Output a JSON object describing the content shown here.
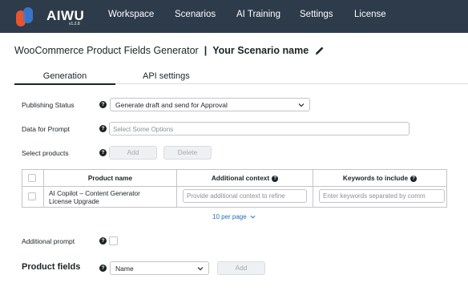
{
  "header": {
    "logo_text": "AIWU",
    "version": "v1.2.8",
    "nav": [
      "Workspace",
      "Scenarios",
      "AI Training",
      "Settings",
      "License"
    ]
  },
  "title": {
    "product": "WooCommerce Product Fields Generator",
    "separator": "|",
    "scenario_name": "Your Scenario name"
  },
  "tabs": [
    "Generation",
    "API settings"
  ],
  "form": {
    "publishing_status": {
      "label": "Publishing Status",
      "value": "Generate draft and send for Approval"
    },
    "data_for_prompt": {
      "label": "Data for Prompt",
      "placeholder": "Select Some Options"
    },
    "select_products": {
      "label": "Select products",
      "add": "Add",
      "delete": "Delete"
    },
    "additional_prompt": {
      "label": "Additional prompt"
    },
    "product_fields": {
      "label": "Product fields",
      "value": "Name",
      "add": "Add"
    }
  },
  "table": {
    "columns": [
      "Product name",
      "Additional context",
      "Keywords to include"
    ],
    "rows": [
      {
        "name_line1": "AI Copilot – Content Generator",
        "name_line2": "License Upgrade",
        "context_placeholder": "Provide additional context to refine",
        "keywords_placeholder": "Enter keywords separated by comm"
      }
    ]
  },
  "pagination": {
    "per_page": "10 per page"
  },
  "help_glyph": "?",
  "colors": {
    "topbar": "#2d3b4b",
    "accent_orange": "#e8542c",
    "accent_blue": "#3a7bd5",
    "link": "#2271b1"
  }
}
